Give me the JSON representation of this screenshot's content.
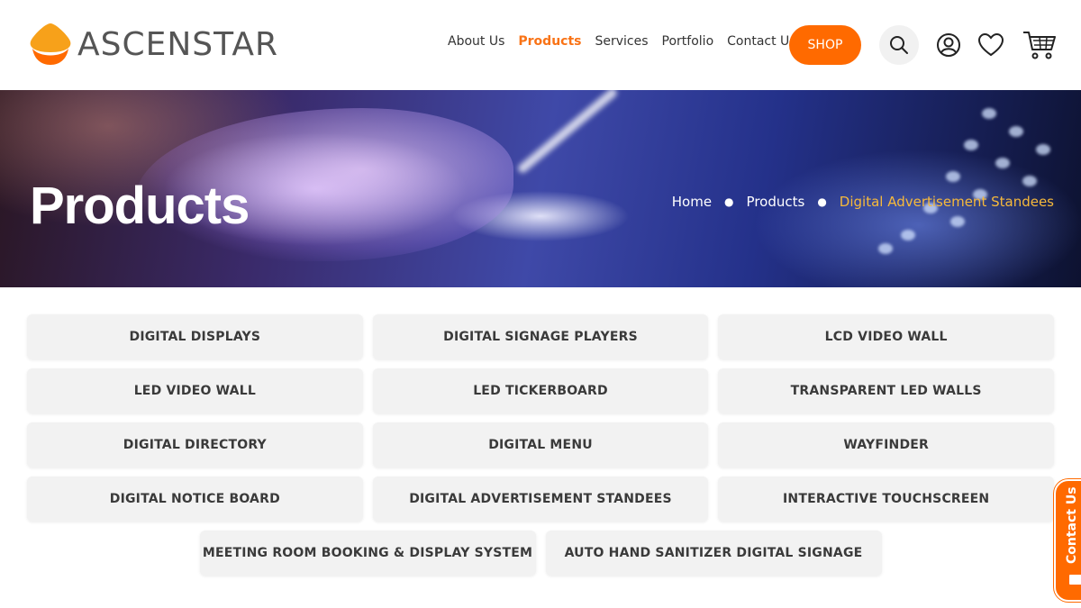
{
  "brand": {
    "name": "ASCENSTAR",
    "accent": "#ff6a00",
    "breadcrumb_current_color": "#f6b93b"
  },
  "nav": {
    "items": [
      {
        "label": "About Us",
        "active": false
      },
      {
        "label": "Products",
        "active": true
      },
      {
        "label": "Services",
        "active": false
      },
      {
        "label": "Portfolio",
        "active": false
      },
      {
        "label": "Contact Us",
        "active": false
      }
    ],
    "shop_label": "SHOP",
    "icons": [
      "search-icon",
      "user-icon",
      "heart-icon",
      "cart-icon"
    ]
  },
  "hero": {
    "title": "Products",
    "breadcrumb": [
      "Home",
      "Products",
      "Digital Advertisement Standees"
    ]
  },
  "products": {
    "rows": [
      [
        "DIGITAL DISPLAYS",
        "DIGITAL SIGNAGE PLAYERS",
        "LCD VIDEO WALL"
      ],
      [
        "LED VIDEO WALL",
        "LED TICKERBOARD",
        "TRANSPARENT LED WALLS"
      ],
      [
        "DIGITAL DIRECTORY",
        "DIGITAL MENU",
        "WAYFINDER"
      ],
      [
        "DIGITAL NOTICE BOARD",
        "DIGITAL ADVERTISEMENT STANDEES",
        "INTERACTIVE TOUCHSCREEN"
      ],
      [
        "MEETING ROOM BOOKING & DISPLAY SYSTEM",
        "AUTO HAND SANITIZER DIGITAL SIGNAGE"
      ]
    ]
  },
  "side_tab": {
    "label": "Contact Us",
    "icon": "envelope-icon"
  }
}
